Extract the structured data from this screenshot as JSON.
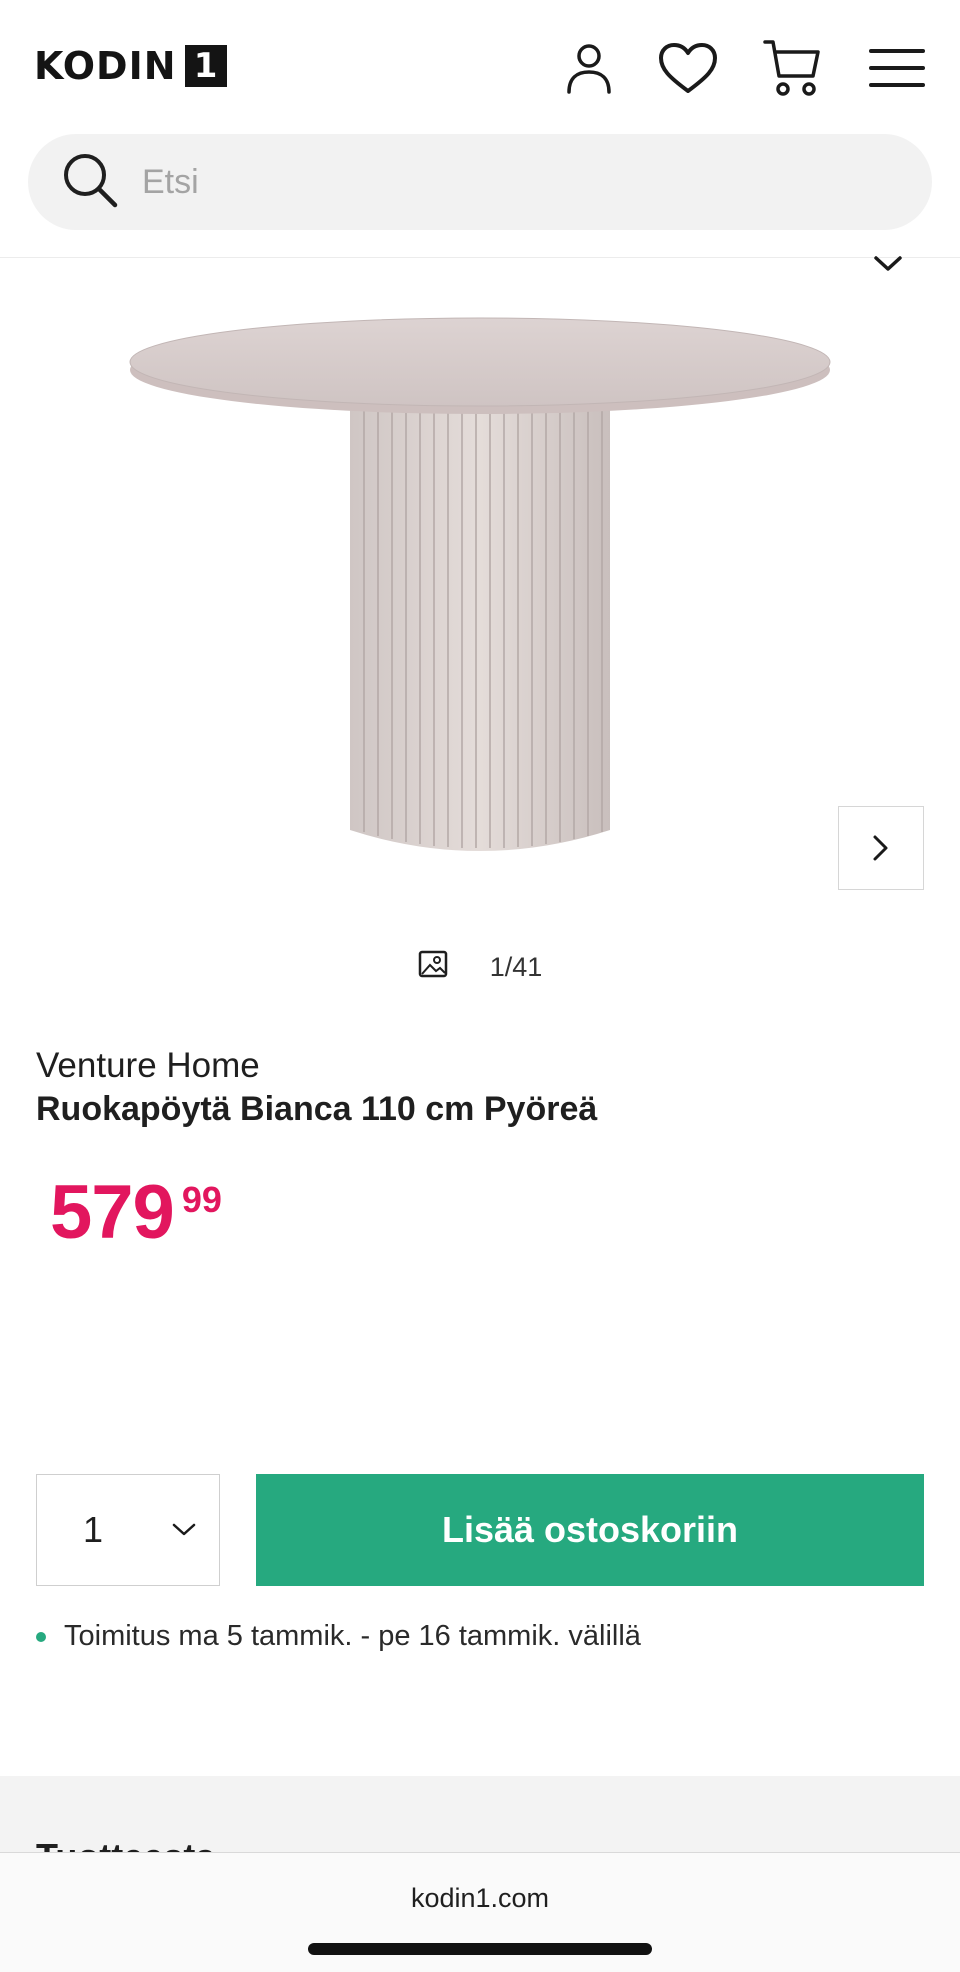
{
  "header": {
    "logo_text": "KODIN",
    "logo_number": "1",
    "icons": [
      "user-icon",
      "heart-icon",
      "cart-icon",
      "menu-icon"
    ]
  },
  "search": {
    "placeholder": "Etsi"
  },
  "gallery": {
    "counter": "1/41"
  },
  "product": {
    "brand": "Venture Home",
    "title": "Ruokapöytä Bianca 110 cm Pyöreä",
    "price_main": "579",
    "price_cents": "99"
  },
  "cart": {
    "quantity": "1",
    "add_label": "Lisää ostoskoriin"
  },
  "delivery": {
    "text": "Toimitus ma 5 tammik. - pe 16 tammik. välillä"
  },
  "section": {
    "heading": "Tuotteesta"
  },
  "browser": {
    "url": "kodin1.com"
  },
  "colors": {
    "price": "#e2165e",
    "primary_button": "#26a97f"
  }
}
